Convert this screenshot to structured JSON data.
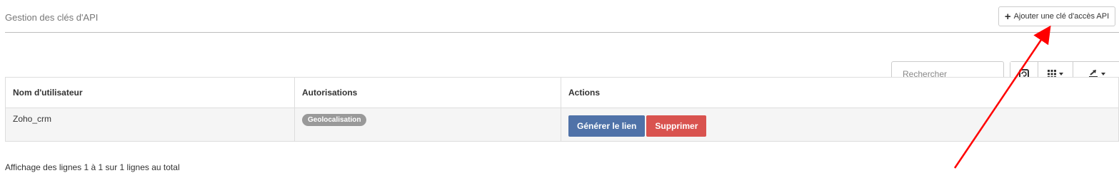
{
  "header": {
    "title": "Gestion des clés d'API",
    "add_button_label": "Ajouter une clé d'accès API"
  },
  "toolbar": {
    "search_placeholder": "Rechercher",
    "buttons": [
      {
        "icon": "refresh-icon"
      },
      {
        "icon": "columns-grid-icon"
      },
      {
        "icon": "export-icon"
      }
    ]
  },
  "table": {
    "columns": [
      "Nom d'utilisateur",
      "Autorisations",
      "Actions"
    ],
    "rows": [
      {
        "username": "Zoho_crm",
        "permission_badge": "Geolocalisation",
        "actions": {
          "generate_label": "Générer le lien",
          "delete_label": "Supprimer"
        }
      }
    ]
  },
  "footer": {
    "pagination_text": "Affichage des lignes 1 à 1 sur 1 lignes au total"
  },
  "colors": {
    "primary": "#4f72a8",
    "danger": "#d9534f",
    "badge": "#999999",
    "annotation_arrow": "#ff0000"
  }
}
